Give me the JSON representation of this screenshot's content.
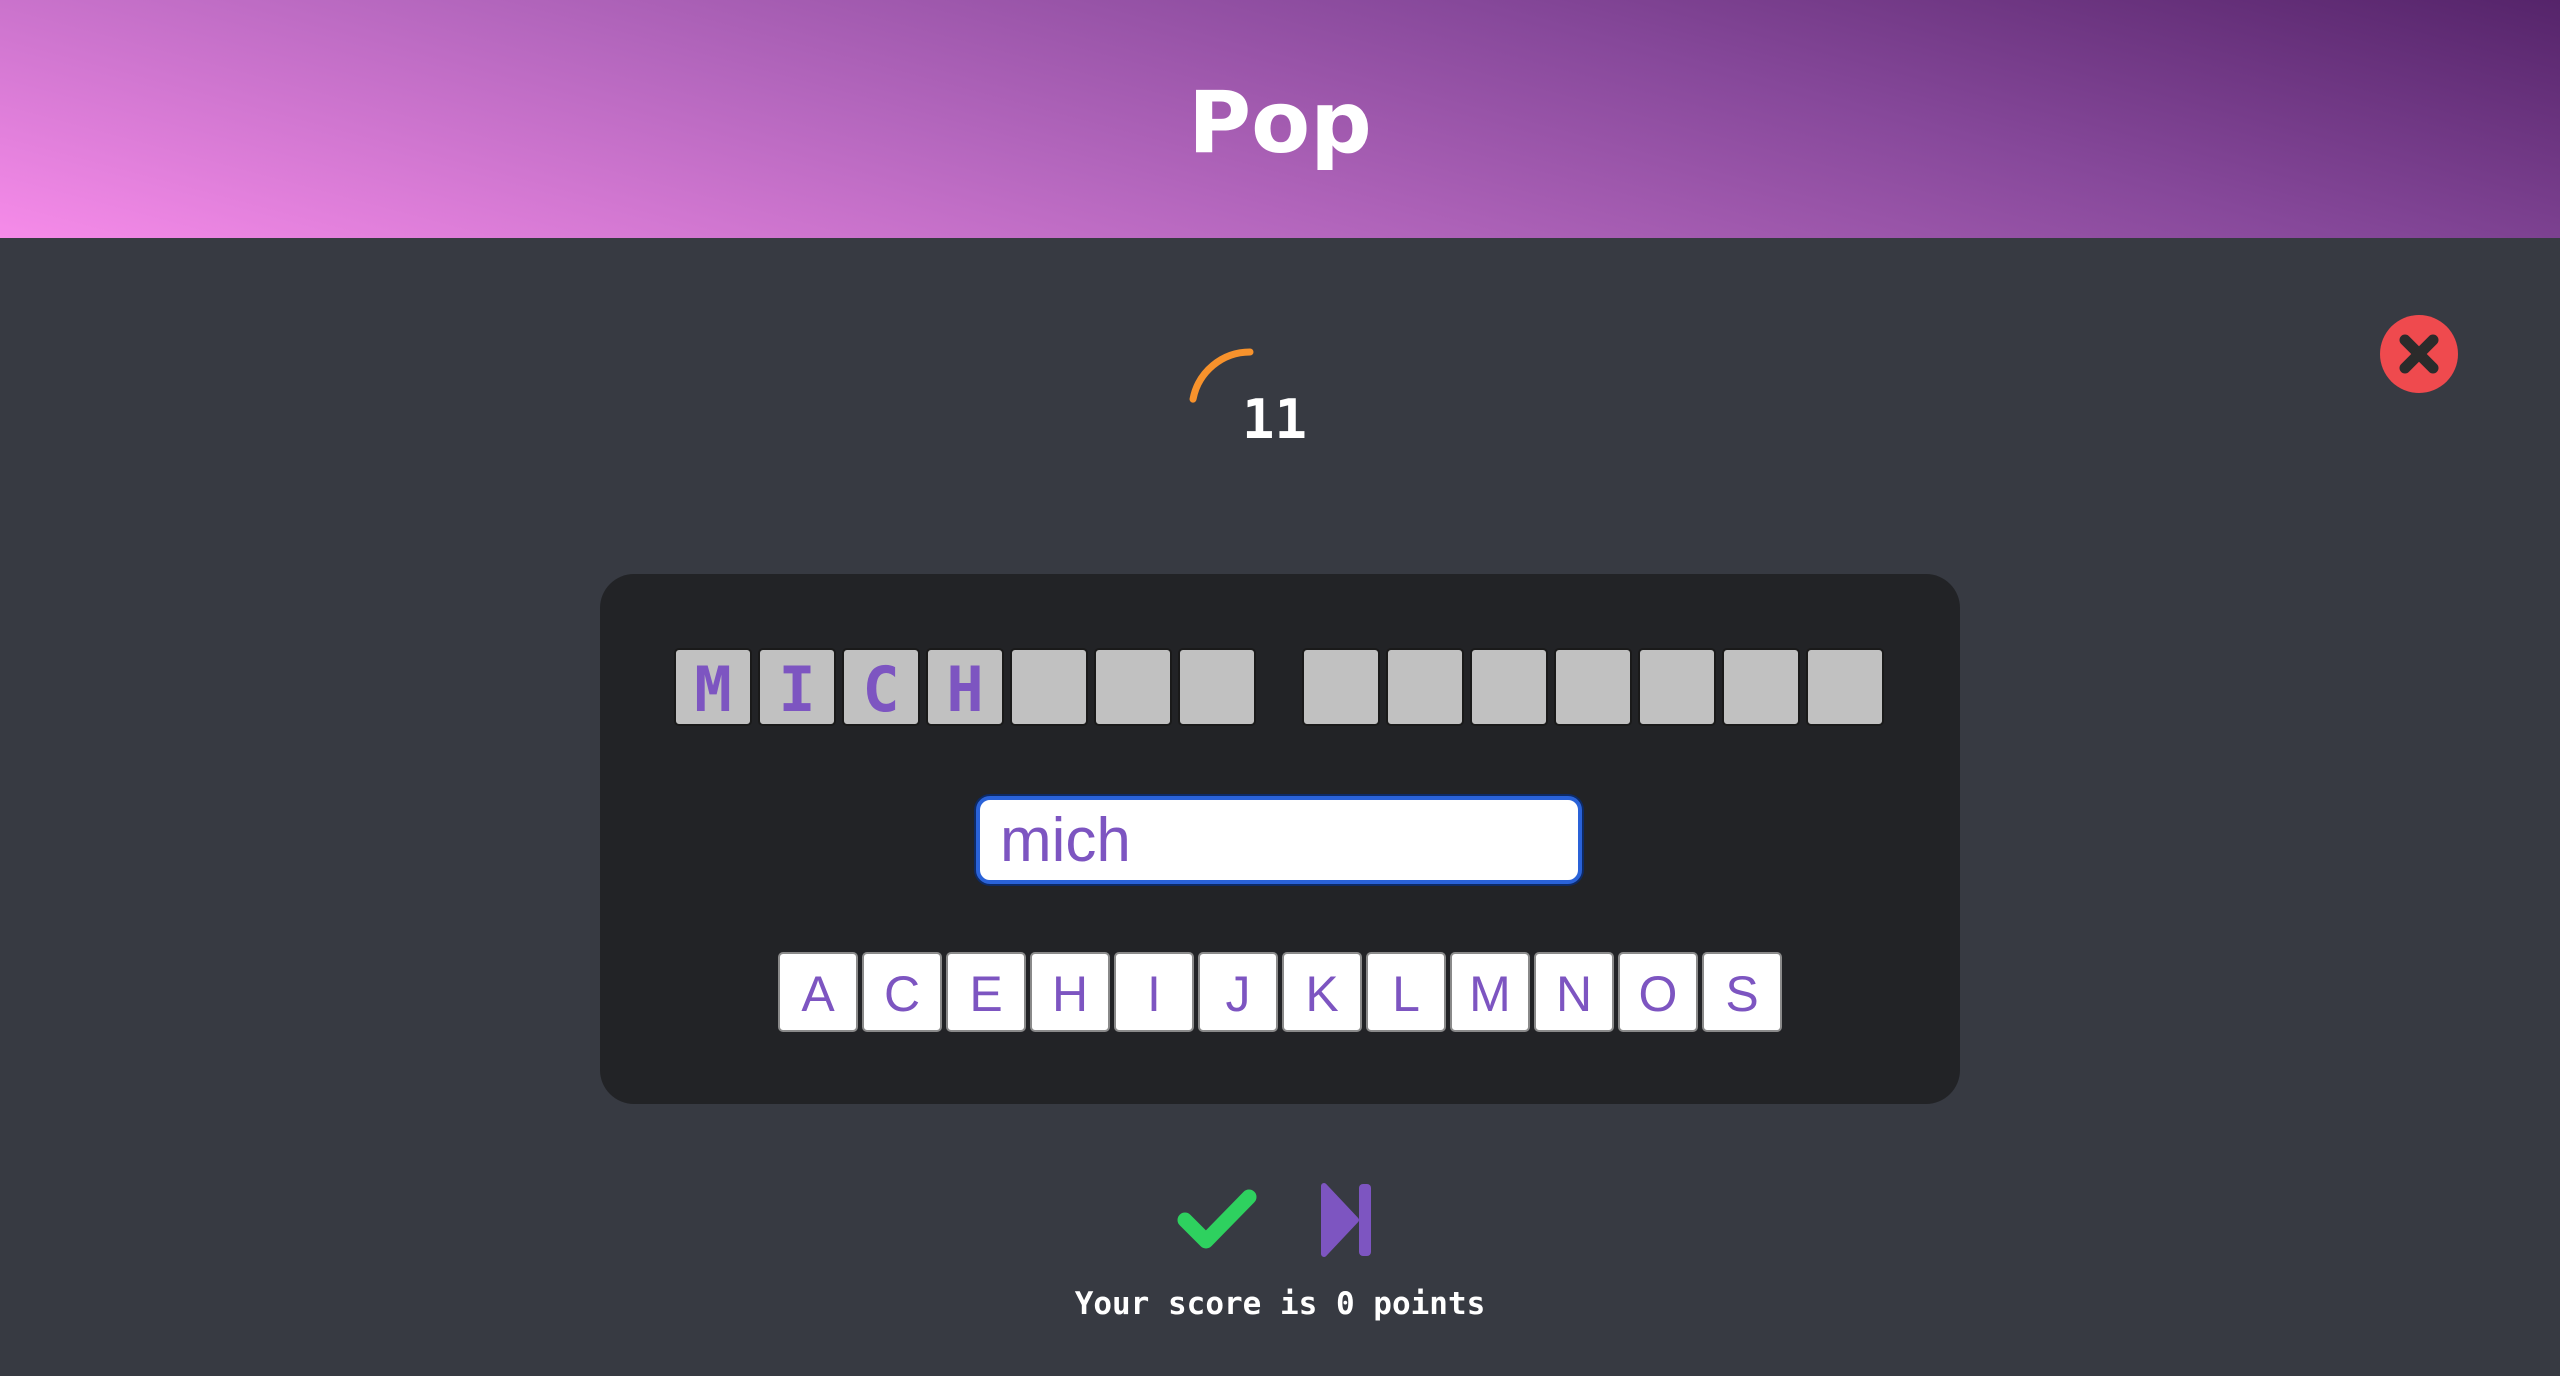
{
  "header": {
    "title": "Pop"
  },
  "timer": {
    "value": "11",
    "remaining_fraction": 0.22,
    "color": "#f7922c"
  },
  "close": {
    "icon": "close-icon",
    "color": "#ef4a4e"
  },
  "answer": {
    "word1": [
      "M",
      "I",
      "C",
      "H",
      "",
      "",
      ""
    ],
    "word2": [
      "",
      "",
      "",
      "",
      "",
      "",
      ""
    ]
  },
  "input": {
    "value": "mich"
  },
  "letters": [
    "A",
    "C",
    "E",
    "H",
    "I",
    "J",
    "K",
    "L",
    "M",
    "N",
    "O",
    "S"
  ],
  "actions": {
    "submit_icon": "checkmark-icon",
    "skip_icon": "skip-forward-icon"
  },
  "score": {
    "text": "Your score is 0 points"
  }
}
